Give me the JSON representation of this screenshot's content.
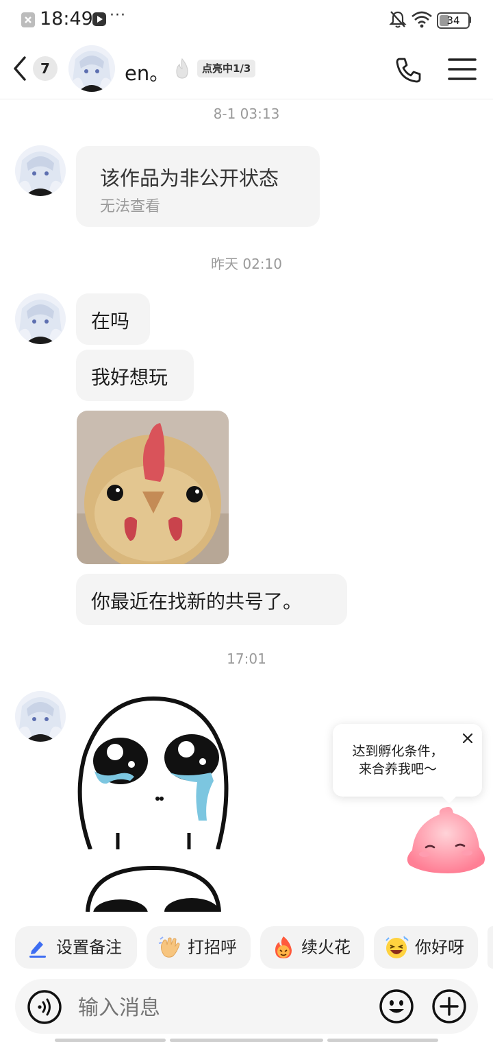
{
  "status_bar": {
    "time": "18:49",
    "more": "···",
    "battery": "34",
    "battery_level": 0.34
  },
  "header": {
    "unread_count": "7",
    "contact_name": "en。",
    "spark_status": "点亮中1/3"
  },
  "messages": {
    "ts1": "8-1 03:13",
    "post_title": "该作品为非公开状态",
    "post_subtitle": "无法查看",
    "ts2": "昨天 02:10",
    "msg1": "在吗",
    "msg2": "我好想玩",
    "msg3": "你最近在找新的共号了。",
    "ts3": "17:01"
  },
  "tooltip": {
    "line1": "达到孵化条件，",
    "line2": "来合养我吧～"
  },
  "quick_replies": [
    {
      "label": "设置备注",
      "icon": "pencil-icon"
    },
    {
      "label": "打招呼",
      "icon": "waving-hand-icon"
    },
    {
      "label": "续火花",
      "icon": "fire-face-icon"
    },
    {
      "label": "你好呀",
      "icon": "laughing-face-icon"
    }
  ],
  "input": {
    "placeholder": "输入消息"
  },
  "colors": {
    "accent_blue": "#3d6df2",
    "bubble_gray": "#f4f4f4",
    "pet_pink": "#ff8fa3"
  }
}
